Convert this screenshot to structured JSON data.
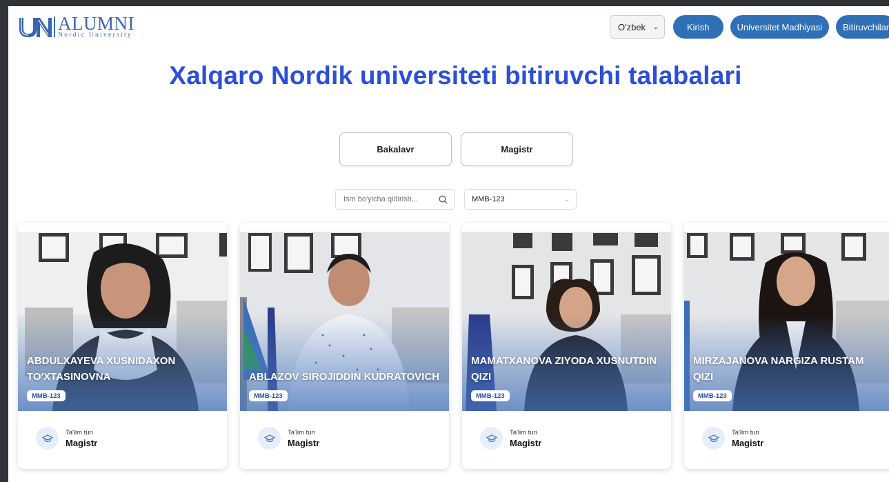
{
  "brand": {
    "main": "ALUMNI",
    "sub": "Nordic University",
    "mark_icon": "un-logo-icon"
  },
  "nav": {
    "language": {
      "selected": "O'zbek"
    },
    "buttons": [
      {
        "label": "Kirish"
      },
      {
        "label": "Universitet Madhiyasi"
      },
      {
        "label": "Bitiruvchilar"
      }
    ]
  },
  "page_title": "Xalqaro Nordik universiteti bitiruvchi talabalari",
  "tabs": [
    {
      "label": "Bakalavr"
    },
    {
      "label": "Magistr"
    }
  ],
  "filters": {
    "search_placeholder": "Ism bo'yicha qidirish...",
    "group_selected": "MMB-123"
  },
  "cards": [
    {
      "name": "ABDULXAYEVA XUSNIDAXON TO'XTASINOVNA",
      "group": "MMB-123",
      "info_label": "Ta'lim turi",
      "info_value": "Magistr"
    },
    {
      "name": "ABLAZOV SIROJIDDIN KUDRATOVICH",
      "group": "MMB-123",
      "info_label": "Ta'lim turi",
      "info_value": "Magistr"
    },
    {
      "name": "MAMATXANOVA ZIYODA XUSNUTDIN QIZI",
      "group": "MMB-123",
      "info_label": "Ta'lim turi",
      "info_value": "Magistr"
    },
    {
      "name": "MIRZAJANOVA NARGIZA RUSTAM QIZI",
      "group": "MMB-123",
      "info_label": "Ta'lim turi",
      "info_value": "Magistr"
    }
  ],
  "colors": {
    "accent": "#2e6fb5",
    "title": "#2b4fd6"
  }
}
